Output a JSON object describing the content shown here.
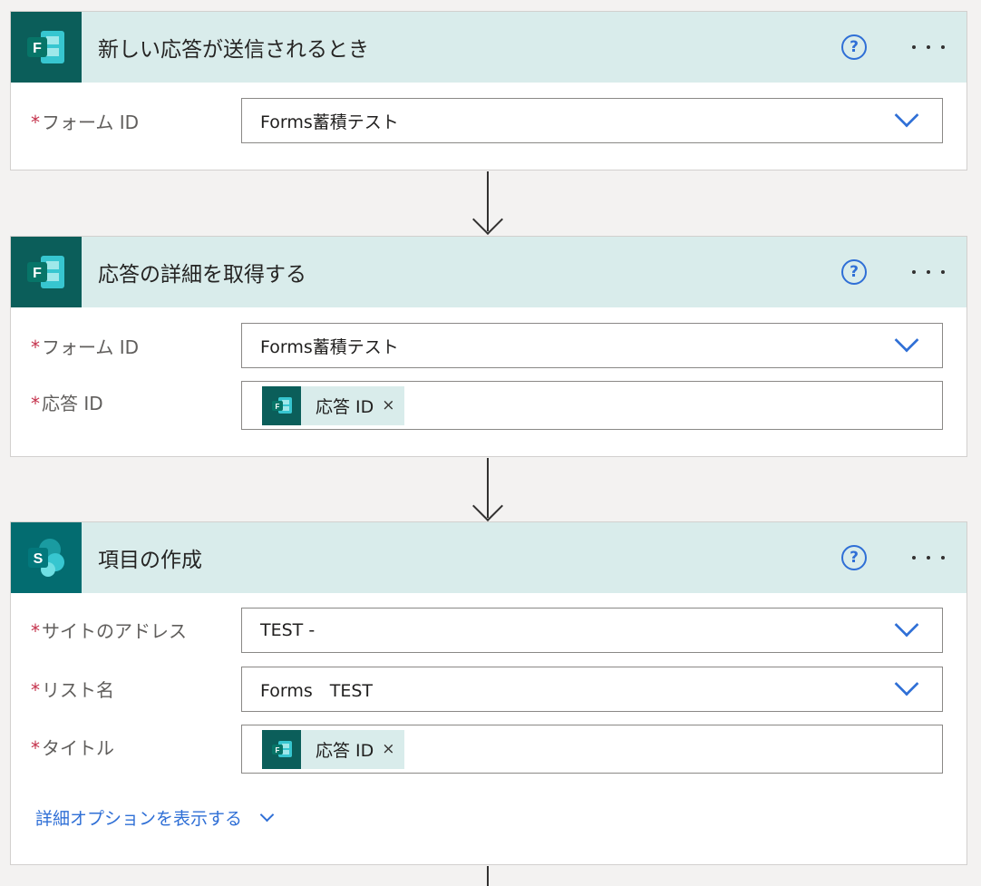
{
  "steps": [
    {
      "app": "forms",
      "title": "新しい応答が送信されるとき",
      "help_label": "?",
      "fields": [
        {
          "label": "フォーム ID",
          "value": "Forms蓄積テスト",
          "kind": "dropdown"
        }
      ]
    },
    {
      "app": "forms",
      "title": "応答の詳細を取得する",
      "help_label": "?",
      "fields": [
        {
          "label": "フォーム ID",
          "value": "Forms蓄積テスト",
          "kind": "dropdown"
        },
        {
          "label": "応答 ID",
          "token": "応答 ID",
          "kind": "token"
        }
      ]
    },
    {
      "app": "sharepoint",
      "title": "項目の作成",
      "help_label": "?",
      "fields": [
        {
          "label": "サイトのアドレス",
          "value": "TEST -",
          "kind": "dropdown"
        },
        {
          "label": "リスト名",
          "value": "Forms　TEST",
          "kind": "dropdown"
        },
        {
          "label": "タイトル",
          "token": "応答 ID",
          "kind": "token"
        }
      ],
      "advanced_link": "詳細オプションを表示する"
    }
  ],
  "common": {
    "required_marker": "*",
    "token_remove": "×"
  },
  "icons": {
    "forms_app": "forms-icon",
    "sharepoint_app": "sharepoint-icon",
    "help": "help-icon",
    "more": "ellipsis-icon",
    "dropdown": "chevron-down-icon"
  },
  "colors": {
    "forms_tile": "#0b5e5a",
    "sharepoint_tile": "#036c70",
    "header_bg": "#d9eceb",
    "accent": "#2f6fd6",
    "required": "#c4314b"
  }
}
